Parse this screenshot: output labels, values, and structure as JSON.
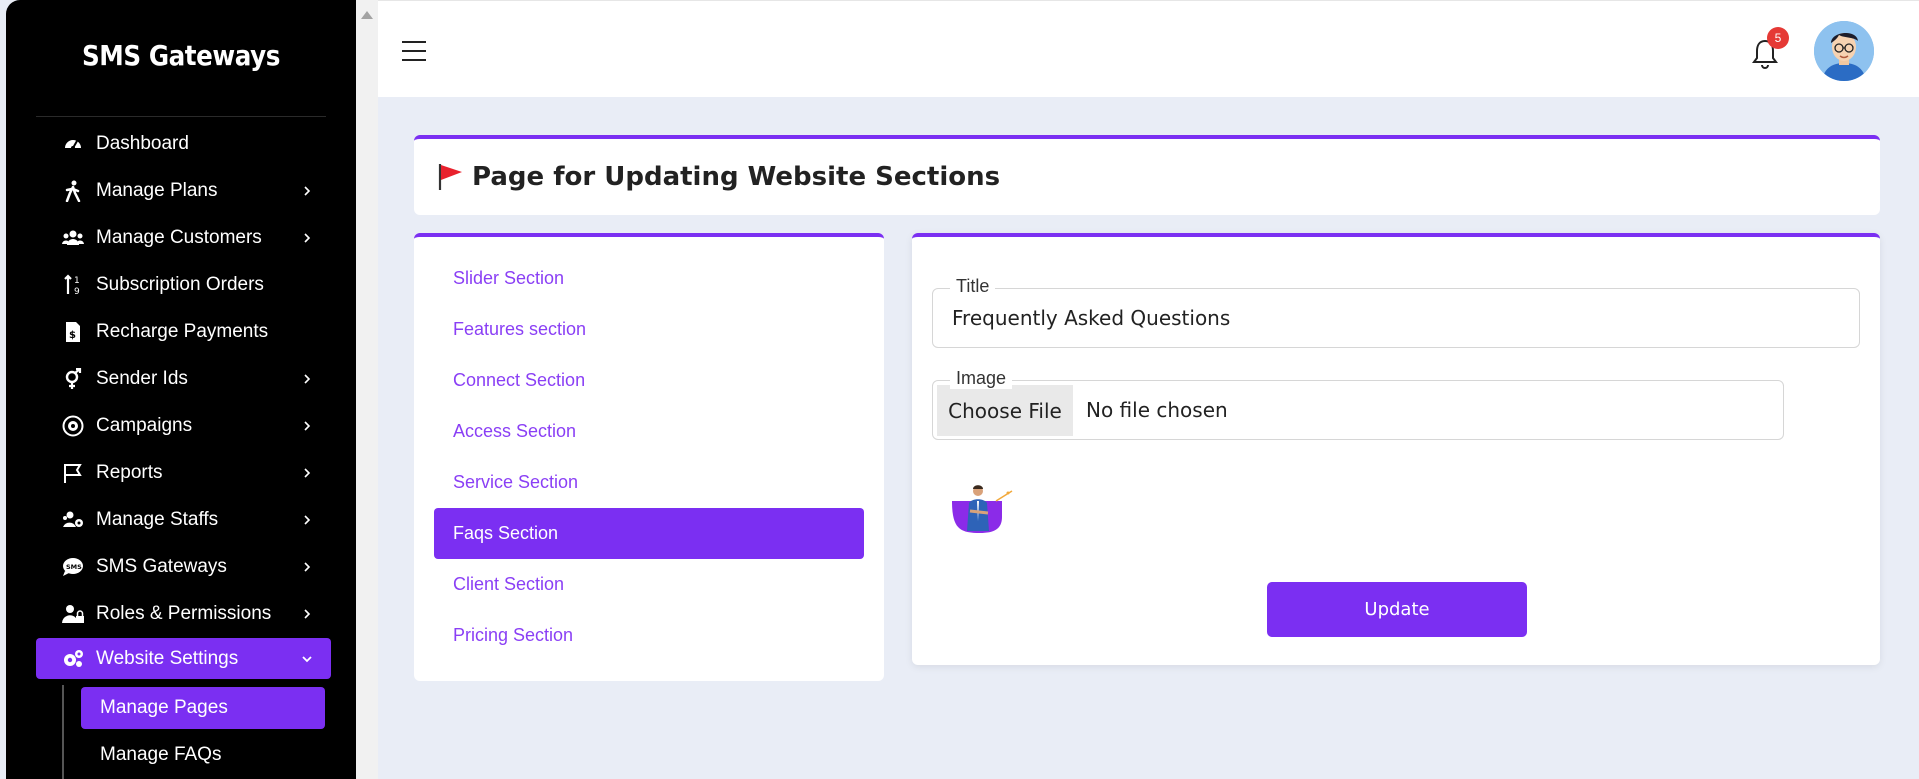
{
  "sidebar": {
    "brand": "SMS Gateways",
    "items": [
      {
        "label": "Dashboard",
        "icon": "gauge-icon",
        "has_submenu": false
      },
      {
        "label": "Manage Plans",
        "icon": "walking-person-icon",
        "has_submenu": true
      },
      {
        "label": "Manage Customers",
        "icon": "users-icon",
        "has_submenu": true
      },
      {
        "label": "Subscription Orders",
        "icon": "sort-icon",
        "has_submenu": false
      },
      {
        "label": "Recharge Payments",
        "icon": "invoice-icon",
        "has_submenu": false
      },
      {
        "label": "Sender Ids",
        "icon": "gender-icon",
        "has_submenu": true
      },
      {
        "label": "Campaigns",
        "icon": "campaign-icon",
        "has_submenu": true
      },
      {
        "label": "Reports",
        "icon": "flag-icon",
        "has_submenu": true
      },
      {
        "label": "Manage Staffs",
        "icon": "staff-gear-icon",
        "has_submenu": true
      },
      {
        "label": "SMS Gateways",
        "icon": "sms-bubble-icon",
        "has_submenu": true
      },
      {
        "label": "Roles & Permissions",
        "icon": "user-lock-icon",
        "has_submenu": true
      },
      {
        "label": "Website Settings",
        "icon": "gears-icon",
        "has_submenu": true,
        "active": true
      }
    ],
    "submenu": [
      {
        "label": "Manage Pages",
        "active": true
      },
      {
        "label": "Manage FAQs",
        "active": false
      }
    ]
  },
  "topbar": {
    "notification_count": "5",
    "accent_color": "#7b2ff2",
    "badge_color": "#e53935"
  },
  "page": {
    "title": "Page for Updating Website Sections"
  },
  "sections": [
    {
      "label": "Slider Section",
      "active": false
    },
    {
      "label": "Features section",
      "active": false
    },
    {
      "label": "Connect Section",
      "active": false
    },
    {
      "label": "Access Section",
      "active": false
    },
    {
      "label": "Service Section",
      "active": false
    },
    {
      "label": "Faqs Section",
      "active": true
    },
    {
      "label": "Client Section",
      "active": false
    },
    {
      "label": "Pricing Section",
      "active": false
    }
  ],
  "form": {
    "title_label": "Title",
    "title_value": "Frequently Asked Questions",
    "image_label": "Image",
    "file_button": "Choose File",
    "file_status": "No file chosen",
    "submit_label": "Update"
  }
}
